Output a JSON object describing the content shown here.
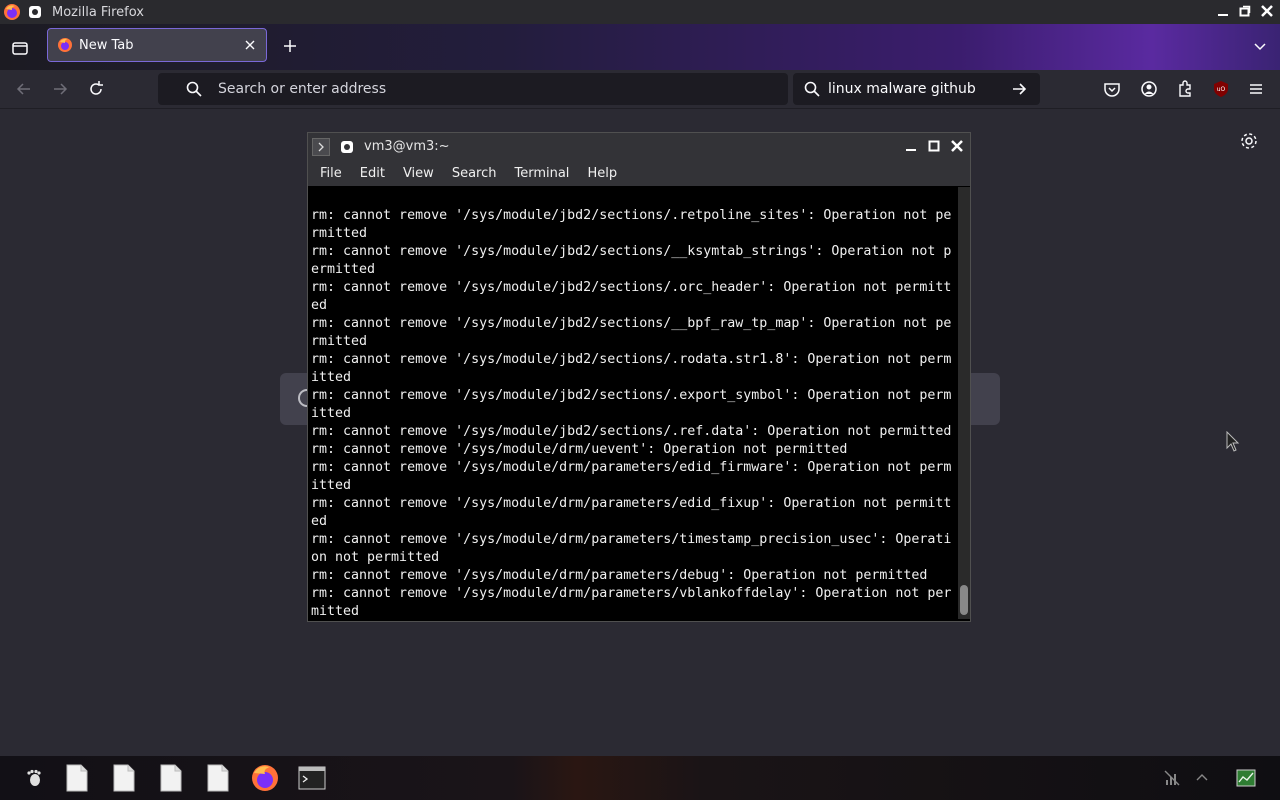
{
  "window": {
    "title": "Mozilla Firefox"
  },
  "tabs": [
    {
      "label": "New Tab"
    }
  ],
  "urlbar": {
    "placeholder": "Search or enter address"
  },
  "searchbar": {
    "query": "linux malware github"
  },
  "ublock_badge": "uO",
  "terminal": {
    "title": "vm3@vm3:~",
    "menu": [
      "File",
      "Edit",
      "View",
      "Search",
      "Terminal",
      "Help"
    ],
    "lines": [
      "rm: cannot remove '/sys/module/jbd2/sections/.retpoline_sites': Operation not pe",
      "rmitted",
      "rm: cannot remove '/sys/module/jbd2/sections/__ksymtab_strings': Operation not p",
      "ermitted",
      "rm: cannot remove '/sys/module/jbd2/sections/.orc_header': Operation not permitt",
      "ed",
      "rm: cannot remove '/sys/module/jbd2/sections/__bpf_raw_tp_map': Operation not pe",
      "rmitted",
      "rm: cannot remove '/sys/module/jbd2/sections/.rodata.str1.8': Operation not perm",
      "itted",
      "rm: cannot remove '/sys/module/jbd2/sections/.export_symbol': Operation not perm",
      "itted",
      "rm: cannot remove '/sys/module/jbd2/sections/.ref.data': Operation not permitted",
      "rm: cannot remove '/sys/module/drm/uevent': Operation not permitted",
      "rm: cannot remove '/sys/module/drm/parameters/edid_firmware': Operation not perm",
      "itted",
      "rm: cannot remove '/sys/module/drm/parameters/edid_fixup': Operation not permitt",
      "ed",
      "rm: cannot remove '/sys/module/drm/parameters/timestamp_precision_usec': Operati",
      "on not permitted",
      "rm: cannot remove '/sys/module/drm/parameters/debug': Operation not permitted",
      "rm: cannot remove '/sys/module/drm/parameters/vblankoffdelay': Operation not per",
      "mitted"
    ]
  },
  "colors": {
    "firefox_bg": "#2b2a33",
    "tab_accent": "#7a68d8",
    "terminal_bg": "#000000",
    "ublock_red": "#800000"
  },
  "taskbar": {
    "icons": [
      "gnome-foot-icon",
      "file-icon",
      "file-icon",
      "file-icon",
      "file-icon",
      "firefox-icon",
      "terminal-icon"
    ]
  }
}
